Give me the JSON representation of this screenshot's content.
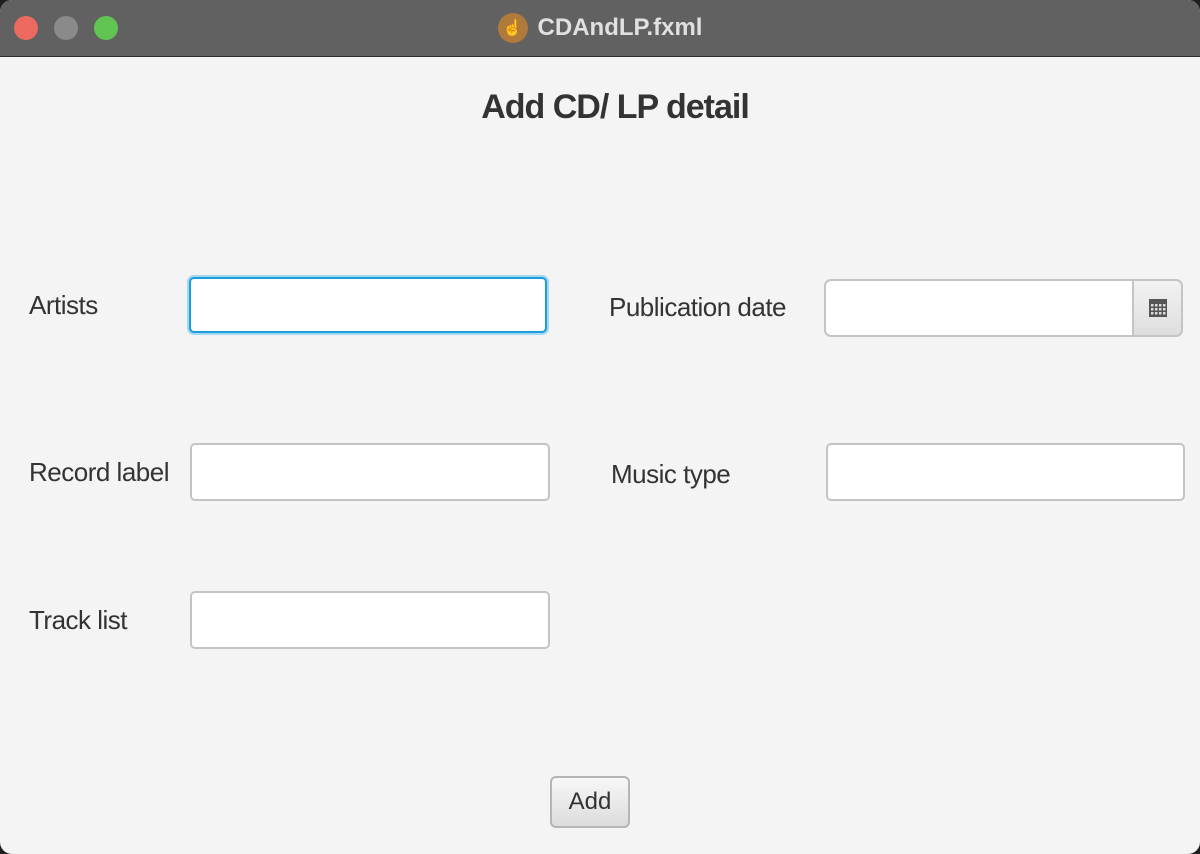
{
  "window": {
    "title": "CDAndLP.fxml",
    "icon": "app-icon"
  },
  "form": {
    "heading": "Add CD/ LP detail",
    "artists": {
      "label": "Artists",
      "value": ""
    },
    "publication_date": {
      "label": "Publication date",
      "value": "",
      "button_icon": "calendar-icon"
    },
    "record_label": {
      "label": "Record label",
      "value": ""
    },
    "music_type": {
      "label": "Music type",
      "value": ""
    },
    "track_list": {
      "label": "Track list",
      "value": ""
    },
    "add_label": "Add"
  },
  "colors": {
    "focus": "#1a9fdc",
    "close": "#ec6a5e",
    "minimize": "#8a8a8a",
    "zoom": "#61c554"
  }
}
